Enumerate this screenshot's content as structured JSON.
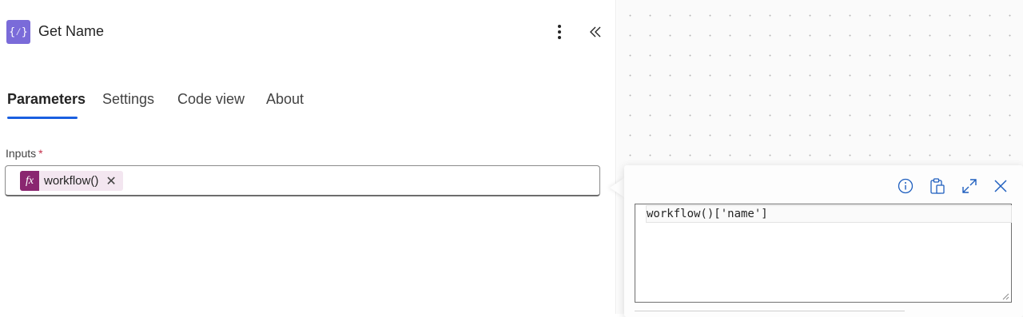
{
  "header": {
    "icon_glyph": "{⁄}",
    "title": "Get Name",
    "more_icon": "more-vertical-icon",
    "collapse_icon": "double-chevron-left-icon"
  },
  "tabs": [
    {
      "label": "Parameters",
      "active": true
    },
    {
      "label": "Settings",
      "active": false
    },
    {
      "label": "Code view",
      "active": false
    },
    {
      "label": "About",
      "active": false
    }
  ],
  "inputs": {
    "label": "Inputs",
    "required_mark": "*",
    "token": {
      "icon_label": "fx",
      "text": "workflow()",
      "remove_glyph": "✕"
    }
  },
  "expression_editor": {
    "value": "workflow()['name']",
    "toolbar": [
      "info-icon",
      "clipboard-icon",
      "expand-icon",
      "close-icon"
    ]
  },
  "colors": {
    "accent": "#1a5fe0",
    "action_icon_bg": "#7a6bd9",
    "token_icon_bg": "#8a2670",
    "token_bg": "#f3e6f0",
    "icon_blue": "#1f5fbf"
  }
}
